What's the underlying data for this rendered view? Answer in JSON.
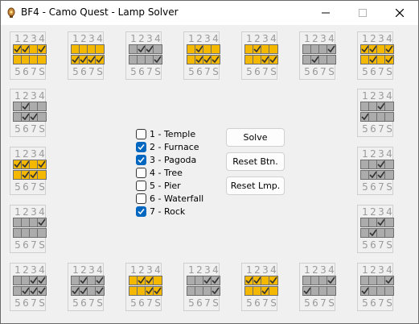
{
  "window": {
    "title": "BF4 - Camo Quest - Lamp Solver"
  },
  "panel_labels": {
    "top": [
      "1",
      "2",
      "3",
      "4"
    ],
    "bottom": [
      "5",
      "6",
      "7",
      "S"
    ]
  },
  "colors": {
    "lamp_on": "#f5b800",
    "lamp_off": "#acacac",
    "check_accent": "#0067c0"
  },
  "panels": [
    [
      [
        "on",
        "on",
        "on",
        "on"
      ],
      [
        "on",
        "on",
        "on",
        "on"
      ],
      [
        "c",
        "c",
        "",
        "c"
      ]
    ],
    [
      [
        "on",
        "on",
        "on",
        "on"
      ],
      [
        "on",
        "on",
        "on",
        "on"
      ],
      [
        "",
        "",
        "",
        "",
        "c",
        "c",
        "c",
        "c"
      ]
    ],
    [
      [
        "off",
        "off",
        "off",
        "off"
      ],
      [
        "off",
        "off",
        "off",
        "off"
      ],
      [
        "",
        "c",
        "c",
        "",
        "",
        "",
        "",
        "c"
      ]
    ],
    [
      [
        "on",
        "on",
        "on",
        "on"
      ],
      [
        "on",
        "on",
        "on",
        "on"
      ],
      [
        "",
        "c",
        "",
        "",
        "",
        "c",
        "c",
        "c"
      ]
    ],
    [
      [
        "on",
        "on",
        "on",
        "on"
      ],
      [
        "on",
        "on",
        "on",
        "on"
      ],
      [
        "",
        "c",
        "",
        "",
        "",
        "",
        "c",
        "c"
      ]
    ],
    [
      [
        "off",
        "off",
        "off",
        "off"
      ],
      [
        "off",
        "off",
        "off",
        "off"
      ],
      [
        "",
        "",
        "",
        "c",
        "",
        "c",
        "",
        ""
      ]
    ],
    [
      [
        "on",
        "on",
        "on",
        "on"
      ],
      [
        "on",
        "on",
        "on",
        "on"
      ],
      [
        "c",
        "c",
        "",
        "c",
        "",
        "c",
        "",
        "c"
      ]
    ],
    [
      [
        "off",
        "off",
        "off",
        "off"
      ],
      [
        "off",
        "off",
        "off",
        "off"
      ],
      [
        "",
        "c",
        "",
        "",
        "",
        "c",
        "c",
        ""
      ]
    ],
    [
      [
        "off",
        "off",
        "off",
        "off"
      ],
      [
        "off",
        "off",
        "off",
        "off"
      ],
      [
        "",
        "",
        "c",
        "",
        "c",
        "",
        "",
        ""
      ]
    ],
    [
      [
        "on",
        "on",
        "on",
        "on"
      ],
      [
        "on",
        "on",
        "on",
        "on"
      ],
      [
        "c",
        "c",
        "",
        "c",
        "",
        "c",
        "c",
        ""
      ]
    ],
    [
      [
        "off",
        "off",
        "off",
        "off"
      ],
      [
        "off",
        "off",
        "off",
        "off"
      ],
      [
        "",
        "",
        "c",
        "",
        "",
        "c",
        "c",
        ""
      ]
    ],
    [
      [
        "off",
        "off",
        "off",
        "off"
      ],
      [
        "off",
        "off",
        "off",
        "off"
      ],
      [
        "",
        "",
        "",
        "c",
        "",
        "",
        "",
        ""
      ]
    ],
    [
      [
        "off",
        "off",
        "off",
        "off"
      ],
      [
        "off",
        "off",
        "off",
        "off"
      ],
      [
        "",
        "",
        "c",
        "",
        "",
        "c",
        "",
        ""
      ]
    ],
    [
      [
        "off",
        "off",
        "off",
        "off"
      ],
      [
        "off",
        "off",
        "off",
        "off"
      ],
      [
        "",
        "",
        "c",
        "c",
        "",
        "c",
        "c",
        "c"
      ]
    ],
    [
      [
        "off",
        "off",
        "off",
        "off"
      ],
      [
        "off",
        "off",
        "off",
        "off"
      ],
      [
        "",
        "c",
        "",
        "c",
        "c",
        "c",
        "",
        "c"
      ]
    ],
    [
      [
        "on",
        "on",
        "on",
        "on"
      ],
      [
        "on",
        "on",
        "on",
        "on"
      ],
      [
        "",
        "c",
        "c",
        "",
        "",
        "",
        "c",
        "c"
      ]
    ],
    [
      [
        "off",
        "off",
        "off",
        "off"
      ],
      [
        "off",
        "off",
        "off",
        "off"
      ],
      [
        "",
        "",
        "c",
        "c",
        "",
        "",
        "",
        "c"
      ]
    ],
    [
      [
        "on",
        "on",
        "on",
        "on"
      ],
      [
        "on",
        "on",
        "on",
        "on"
      ],
      [
        "c",
        "c",
        "",
        "c",
        "",
        "",
        "c",
        ""
      ]
    ],
    [
      [
        "off",
        "off",
        "off",
        "off"
      ],
      [
        "off",
        "off",
        "off",
        "off"
      ],
      [
        "",
        "",
        "",
        "c",
        "c",
        "",
        "",
        ""
      ]
    ]
  ],
  "options": [
    {
      "label": "1 - Temple",
      "checked": false
    },
    {
      "label": "2 - Furnace",
      "checked": true
    },
    {
      "label": "3 - Pagoda",
      "checked": true
    },
    {
      "label": "4 - Tree",
      "checked": false
    },
    {
      "label": "5 - Pier",
      "checked": false
    },
    {
      "label": "6 - Waterfall",
      "checked": false
    },
    {
      "label": "7 - Rock",
      "checked": true
    }
  ],
  "buttons": {
    "solve": "Solve",
    "reset_buttons": "Reset Btn.",
    "reset_lamps": "Reset Lmp."
  }
}
